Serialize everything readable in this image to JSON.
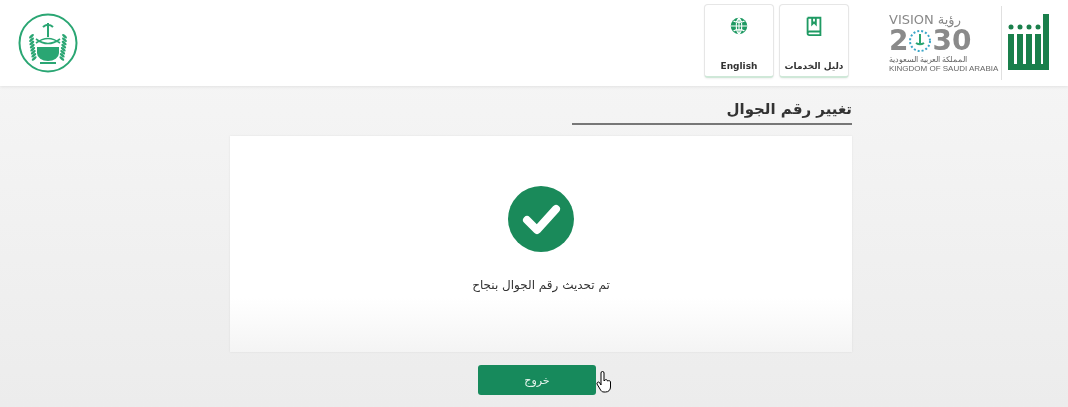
{
  "header": {
    "nav_buttons": [
      {
        "kind": "guide",
        "label": "دليل الخدمات"
      },
      {
        "kind": "language",
        "label": "English"
      }
    ],
    "vision_logo": {
      "word_en": "VISION",
      "word_ar": "رؤية",
      "year_start": "2",
      "year_end": "30",
      "line_ar": "المملكة العربية السعودية",
      "line_en": "KINGDOM OF SAUDI ARABIA"
    }
  },
  "page_title": "تغيير رقم الجوال",
  "result": {
    "kind": "success",
    "message": "تم تحديث رقم الجوال بنجاح"
  },
  "exit_button": "خروج"
}
